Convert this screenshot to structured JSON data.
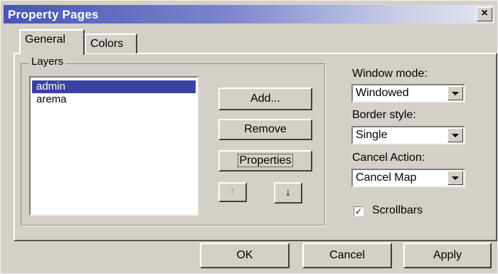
{
  "window": {
    "title": "Property Pages",
    "close_symbol": "×"
  },
  "tabs": [
    {
      "label": "General",
      "active": true
    },
    {
      "label": "Colors",
      "active": false
    }
  ],
  "layers": {
    "group_label": "Layers",
    "items": [
      "admin",
      "arema"
    ],
    "selected": "admin"
  },
  "layer_buttons": {
    "add": "Add...",
    "remove": "Remove",
    "properties": "Properties",
    "move_up_symbol": "↑",
    "move_down_symbol": "↓"
  },
  "settings": {
    "window_mode": {
      "label": "Window mode:",
      "value": "Windowed"
    },
    "border_style": {
      "label": "Border style:",
      "value": "Single"
    },
    "cancel_action": {
      "label": "Cancel Action:",
      "value": "Cancel Map"
    },
    "scrollbars": {
      "label": "Scrollbars",
      "checked": true,
      "check_symbol": "✓"
    }
  },
  "dialog_buttons": {
    "ok": "OK",
    "cancel": "Cancel",
    "apply": "Apply"
  },
  "colors": {
    "selection": "#3b42a2",
    "title_gradient_start": "#4756b6",
    "face": "#d4d0c8"
  }
}
